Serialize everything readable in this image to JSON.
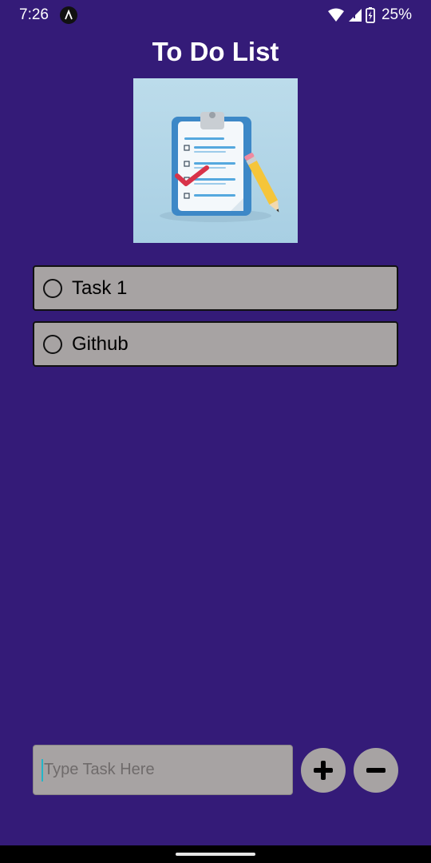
{
  "status_bar": {
    "time": "7:26",
    "battery": "25%"
  },
  "header": {
    "title": "To Do List"
  },
  "hero_image": {
    "icon": "clipboard-checklist-illustration"
  },
  "tasks": [
    {
      "label": "Task 1",
      "checked": false
    },
    {
      "label": "Github",
      "checked": false
    }
  ],
  "input": {
    "placeholder": "Type Task Here",
    "value": ""
  },
  "actions": {
    "add_icon": "plus-icon",
    "remove_icon": "minus-icon"
  },
  "colors": {
    "background": "#341b78",
    "item_fill": "#a7a3a3",
    "item_border": "#111111",
    "caret": "#23b6c8"
  }
}
